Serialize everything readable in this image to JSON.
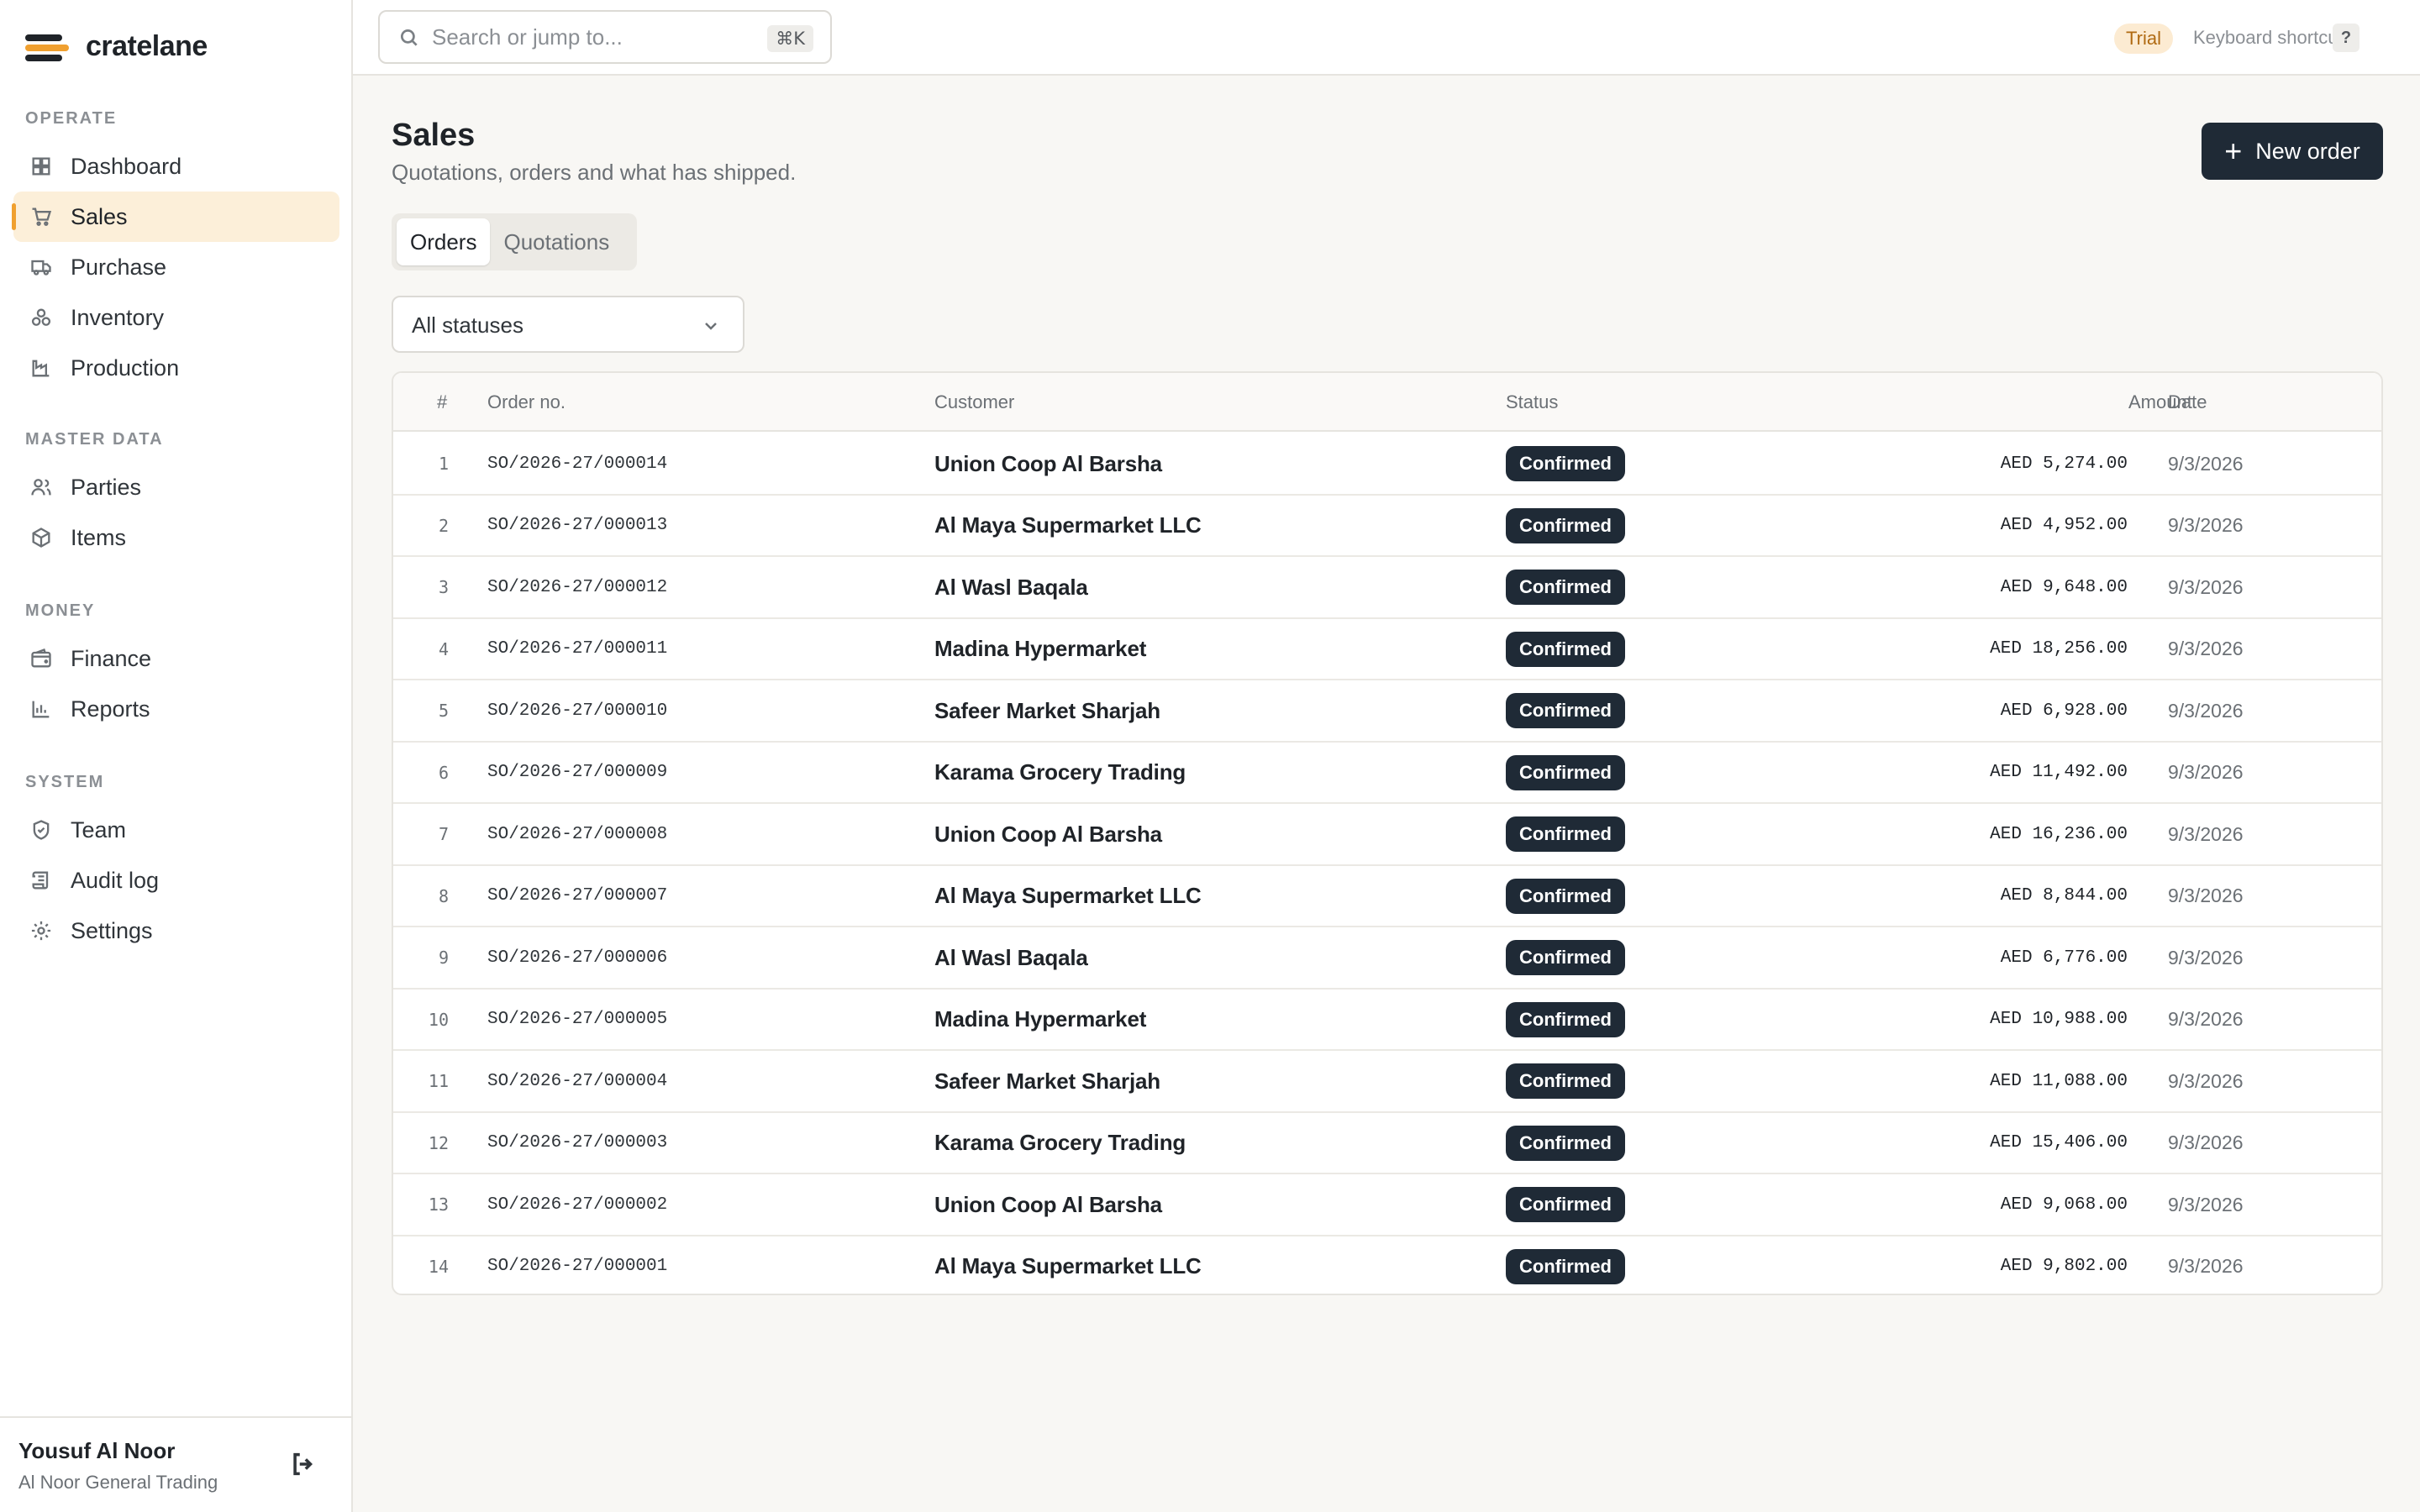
{
  "app": {
    "name": "cratelane"
  },
  "sidebar": {
    "sections": [
      {
        "heading": "OPERATE",
        "items": [
          {
            "label": "Dashboard",
            "icon": "grid-icon"
          },
          {
            "label": "Sales",
            "icon": "cart-icon",
            "active": true
          },
          {
            "label": "Purchase",
            "icon": "truck-icon"
          },
          {
            "label": "Inventory",
            "icon": "boxes-icon"
          },
          {
            "label": "Production",
            "icon": "factory-icon"
          }
        ]
      },
      {
        "heading": "MASTER DATA",
        "items": [
          {
            "label": "Parties",
            "icon": "users-icon"
          },
          {
            "label": "Items",
            "icon": "package-icon"
          }
        ]
      },
      {
        "heading": "MONEY",
        "items": [
          {
            "label": "Finance",
            "icon": "wallet-icon"
          },
          {
            "label": "Reports",
            "icon": "bar-chart-icon"
          }
        ]
      },
      {
        "heading": "SYSTEM",
        "items": [
          {
            "label": "Team",
            "icon": "shield-icon"
          },
          {
            "label": "Audit log",
            "icon": "scroll-icon"
          },
          {
            "label": "Settings",
            "icon": "gear-icon"
          }
        ]
      }
    ],
    "user": {
      "name": "Yousuf Al Noor",
      "org": "Al Noor General Trading"
    }
  },
  "topbar": {
    "search_placeholder": "Search or jump to...",
    "search_shortcut": "⌘K",
    "trial_label": "Trial",
    "shortcuts_label": "Keyboard shortcuts",
    "shortcuts_key": "?"
  },
  "page": {
    "title": "Sales",
    "subtitle": "Quotations, orders and what has shipped.",
    "new_button": "New order",
    "tabs": [
      {
        "label": "Orders",
        "active": true
      },
      {
        "label": "Quotations",
        "active": false
      }
    ],
    "filter": {
      "selected": "All statuses"
    }
  },
  "table": {
    "columns": {
      "idx": "#",
      "order": "Order no.",
      "customer": "Customer",
      "status": "Status",
      "amount": "Amount",
      "date": "Date"
    },
    "rows": [
      {
        "idx": "1",
        "order": "SO/2026-27/000014",
        "customer": "Union Coop Al Barsha",
        "status": "Confirmed",
        "amount": "AED 5,274.00",
        "date": "9/3/2026"
      },
      {
        "idx": "2",
        "order": "SO/2026-27/000013",
        "customer": "Al Maya Supermarket LLC",
        "status": "Confirmed",
        "amount": "AED 4,952.00",
        "date": "9/3/2026"
      },
      {
        "idx": "3",
        "order": "SO/2026-27/000012",
        "customer": "Al Wasl Baqala",
        "status": "Confirmed",
        "amount": "AED 9,648.00",
        "date": "9/3/2026"
      },
      {
        "idx": "4",
        "order": "SO/2026-27/000011",
        "customer": "Madina Hypermarket",
        "status": "Confirmed",
        "amount": "AED 18,256.00",
        "date": "9/3/2026"
      },
      {
        "idx": "5",
        "order": "SO/2026-27/000010",
        "customer": "Safeer Market Sharjah",
        "status": "Confirmed",
        "amount": "AED 6,928.00",
        "date": "9/3/2026"
      },
      {
        "idx": "6",
        "order": "SO/2026-27/000009",
        "customer": "Karama Grocery Trading",
        "status": "Confirmed",
        "amount": "AED 11,492.00",
        "date": "9/3/2026"
      },
      {
        "idx": "7",
        "order": "SO/2026-27/000008",
        "customer": "Union Coop Al Barsha",
        "status": "Confirmed",
        "amount": "AED 16,236.00",
        "date": "9/3/2026"
      },
      {
        "idx": "8",
        "order": "SO/2026-27/000007",
        "customer": "Al Maya Supermarket LLC",
        "status": "Confirmed",
        "amount": "AED 8,844.00",
        "date": "9/3/2026"
      },
      {
        "idx": "9",
        "order": "SO/2026-27/000006",
        "customer": "Al Wasl Baqala",
        "status": "Confirmed",
        "amount": "AED 6,776.00",
        "date": "9/3/2026"
      },
      {
        "idx": "10",
        "order": "SO/2026-27/000005",
        "customer": "Madina Hypermarket",
        "status": "Confirmed",
        "amount": "AED 10,988.00",
        "date": "9/3/2026"
      },
      {
        "idx": "11",
        "order": "SO/2026-27/000004",
        "customer": "Safeer Market Sharjah",
        "status": "Confirmed",
        "amount": "AED 11,088.00",
        "date": "9/3/2026"
      },
      {
        "idx": "12",
        "order": "SO/2026-27/000003",
        "customer": "Karama Grocery Trading",
        "status": "Confirmed",
        "amount": "AED 15,406.00",
        "date": "9/3/2026"
      },
      {
        "idx": "13",
        "order": "SO/2026-27/000002",
        "customer": "Union Coop Al Barsha",
        "status": "Confirmed",
        "amount": "AED 9,068.00",
        "date": "9/3/2026"
      },
      {
        "idx": "14",
        "order": "SO/2026-27/000001",
        "customer": "Al Maya Supermarket LLC",
        "status": "Confirmed",
        "amount": "AED 9,802.00",
        "date": "9/3/2026"
      }
    ]
  }
}
